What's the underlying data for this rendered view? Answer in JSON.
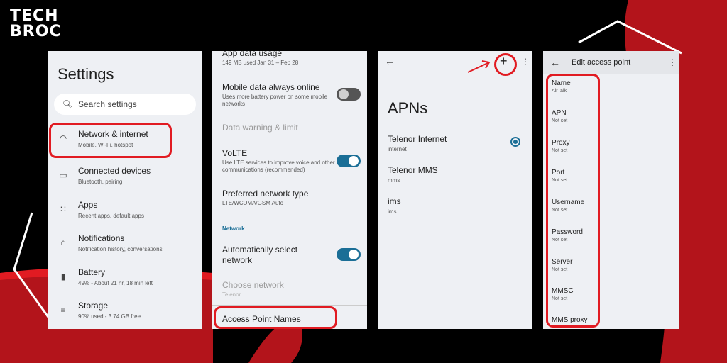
{
  "logo": {
    "line1": "TECH",
    "line2": "BROC"
  },
  "settings": {
    "title": "Settings",
    "search_placeholder": "Search settings",
    "items": [
      {
        "title": "Network & internet",
        "subtitle": "Mobile, Wi-Fi, hotspot",
        "icon": "wifi-icon"
      },
      {
        "title": "Connected devices",
        "subtitle": "Bluetooth, pairing",
        "icon": "devices-icon"
      },
      {
        "title": "Apps",
        "subtitle": "Recent apps, default apps",
        "icon": "apps-icon"
      },
      {
        "title": "Notifications",
        "subtitle": "Notification history, conversations",
        "icon": "bell-icon"
      },
      {
        "title": "Battery",
        "subtitle": "49% - About 21 hr, 18 min left",
        "icon": "battery-icon"
      },
      {
        "title": "Storage",
        "subtitle": "90% used - 3.74 GB free",
        "icon": "storage-icon"
      }
    ]
  },
  "network": {
    "app_data_usage": {
      "title": "App data usage",
      "subtitle": "149 MB used Jan 31 – Feb 28"
    },
    "mobile_data_always_online": {
      "title": "Mobile data always online",
      "subtitle": "Uses more battery power on some mobile networks",
      "enabled": false
    },
    "data_warning": {
      "title": "Data warning & limit"
    },
    "volte": {
      "title": "VoLTE",
      "subtitle": "Use LTE services to improve voice and other communications (recommended)",
      "enabled": true
    },
    "preferred_network": {
      "title": "Preferred network type",
      "subtitle": "LTE/WCDMA/GSM Auto"
    },
    "section_label": "Network",
    "auto_select": {
      "title": "Automatically select network",
      "enabled": true
    },
    "choose_network": {
      "title": "Choose network",
      "subtitle": "Telenor"
    },
    "access_point_names": {
      "title": "Access Point Names"
    }
  },
  "apns": {
    "title": "APNs",
    "items": [
      {
        "title": "Telenor Internet",
        "subtitle": "internet",
        "selected": true
      },
      {
        "title": "Telenor MMS",
        "subtitle": "mms",
        "selected": false
      },
      {
        "title": "ims",
        "subtitle": "ims",
        "selected": false
      }
    ]
  },
  "edit_ap": {
    "title": "Edit access point",
    "fields": [
      {
        "label": "Name",
        "value": "AirTalk"
      },
      {
        "label": "APN",
        "value": "Not set"
      },
      {
        "label": "Proxy",
        "value": "Not set"
      },
      {
        "label": "Port",
        "value": "Not set"
      },
      {
        "label": "Username",
        "value": "Not set"
      },
      {
        "label": "Password",
        "value": "Not set"
      },
      {
        "label": "Server",
        "value": "Not set"
      },
      {
        "label": "MMSC",
        "value": "Not set"
      },
      {
        "label": "MMS proxy",
        "value": ""
      }
    ]
  },
  "colors": {
    "accent": "#1a6e96",
    "highlight": "#e11b22",
    "brand_red": "#c4151c"
  }
}
